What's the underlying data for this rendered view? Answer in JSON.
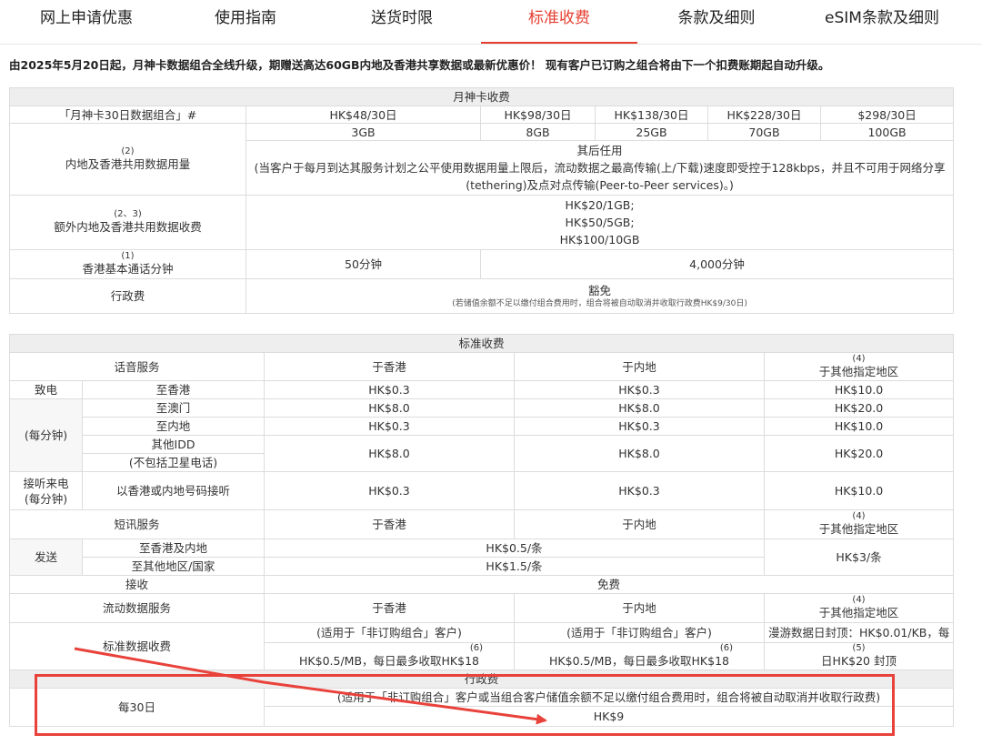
{
  "tabs": [
    "网上申请优惠",
    "使用指南",
    "送货时限",
    "标准收费",
    "条款及细则",
    "eSIM条款及细则"
  ],
  "notice": "由2025年5月20日起，月神卡数据组合全线升级，期赠送高达60GB内地及香港共享数据或最新优惠价！ 现有客户已订购之组合将由下一个扣费账期起自动升级。",
  "plan_table": {
    "title": "月神卡收费",
    "row_plan_label": "「月神卡30日数据组合」#",
    "prices": [
      "HK$48/30日",
      "HK$98/30日",
      "HK$138/30日",
      "HK$228/30日",
      "$298/30日"
    ],
    "data_amounts": [
      "3GB",
      "8GB",
      "25GB",
      "70GB",
      "100GB"
    ],
    "data_label": "内地及香港共用数据用量",
    "data_label_sup": "(2)",
    "after_title": "其后任用",
    "after_text": "(当客户于每月到达其服务计划之公平使用数据用量上限后，流动数据之最高传输(上/下载)速度即受控于128kbps，并且不可用于网络分享(tethering)及点对点传输(Peer-to-Peer services)。)",
    "extra_label": "额外内地及香港共用数据收费",
    "extra_sup": "(2、3)",
    "extra_rates": [
      "HK$20/1GB;",
      "HK$50/5GB;",
      "HK$100/10GB"
    ],
    "minutes_label": "香港基本通话分钟",
    "minutes_sup": "(1)",
    "minutes_values": [
      "50分钟",
      "4,000分钟"
    ],
    "admin_label": "行政费",
    "admin_value": "豁免",
    "admin_note": "(若储值余额不足以缴付组合费用时，组合将被自动取消并收取行政费HK$9/30日)"
  },
  "std_table": {
    "title": "标准收费",
    "voice_label": "话音服务",
    "col_hk": "于香港",
    "col_mainland": "于内地",
    "col_other": "于其他指定地区",
    "col_other_sup": "(4)",
    "call_label_a": "致电",
    "call_label_b": "(每分钟)",
    "dest": [
      "至香港",
      "至澳门",
      "至内地",
      "其他IDD",
      "(不包括卫星电话)"
    ],
    "rates": [
      [
        "HK$0.3",
        "HK$0.3",
        "HK$10.0"
      ],
      [
        "HK$8.0",
        "HK$8.0",
        "HK$20.0"
      ],
      [
        "HK$0.3",
        "HK$0.3",
        "HK$10.0"
      ],
      [
        "HK$8.0",
        "HK$8.0",
        "HK$20.0"
      ]
    ],
    "incoming_label_a": "接听来电",
    "incoming_label_b": "(每分钟)",
    "incoming_desc": "以香港或内地号码接听",
    "incoming_rates": [
      "HK$0.3",
      "HK$0.3",
      "HK$10.0"
    ],
    "sms_label": "短讯服务",
    "send_label": "发送",
    "sms_dest": [
      "至香港及内地",
      "至其他地区/国家"
    ],
    "sms_rates": [
      "HK$0.5/条",
      "HK$1.5/条"
    ],
    "sms_other": "HK$3/条",
    "receive_label": "接收",
    "receive_value": "免费",
    "data_label": "流动数据服务",
    "std_data_label": "标准数据收费",
    "nonsub_note": "(适用于「非订购组合」客户)",
    "data_rate": "HK$0.5/MB，每日最多收取HK$18",
    "data_rate_sup": "(6)",
    "roam_a": "漫游数据日封顶：HK$0.01/KB，每",
    "roam_b": "日HK$20 封顶",
    "roam_sup": "(5)",
    "admin_title": "行政费",
    "admin_period": "每30日",
    "admin_note": "(适用于「非订购组合」客户或当组合客户储值余额不足以缴付组合费用时，组合将被自动取消并收取行政费)",
    "admin_fee": "HK$9"
  },
  "colors": {
    "accent": "#e53e30",
    "annotation": "#e8423b"
  }
}
